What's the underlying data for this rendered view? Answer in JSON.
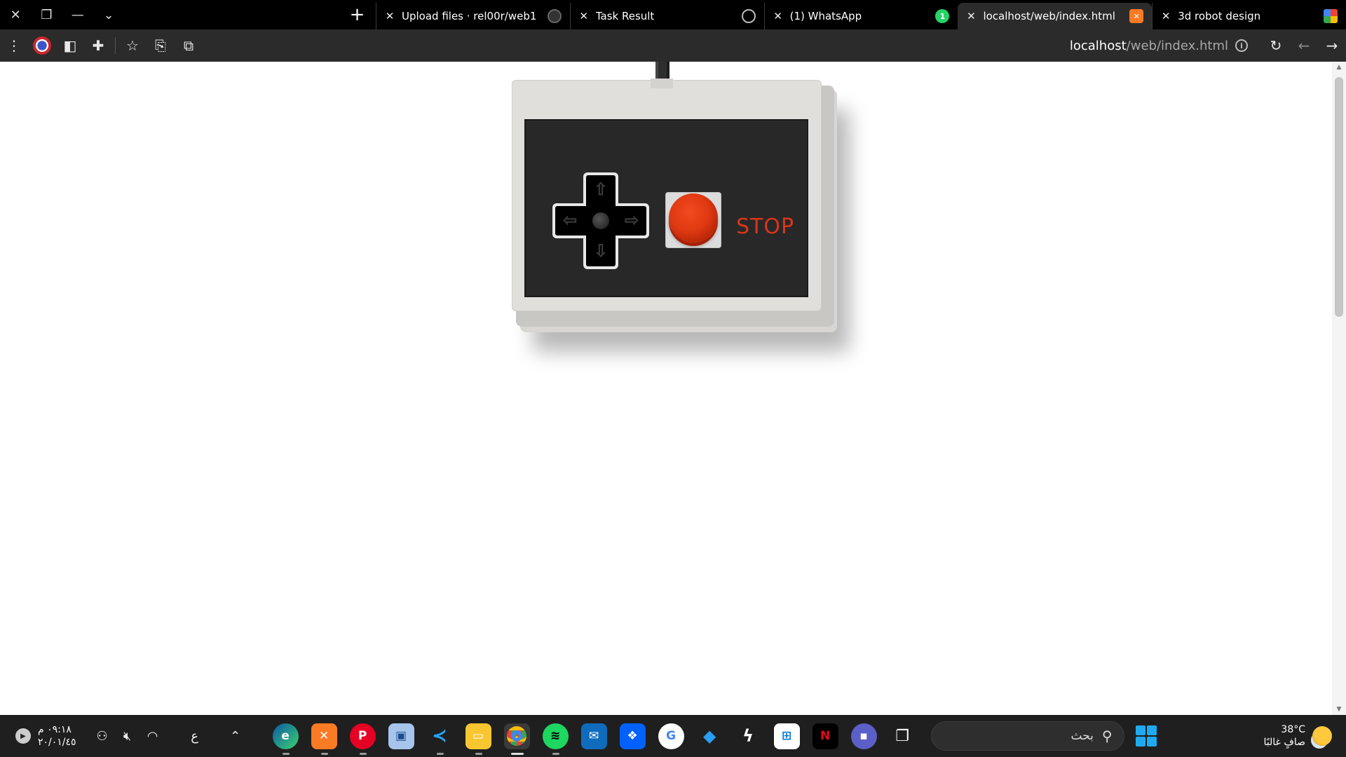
{
  "browser": {
    "window_controls": [
      "close",
      "restore",
      "minimize",
      "menu"
    ],
    "tabs": [
      {
        "title": "Upload files · rel00r/web1",
        "favicon": "github-icon"
      },
      {
        "title": "Task Result",
        "favicon": "globe-icon"
      },
      {
        "title": "(1) WhatsApp",
        "favicon": "whatsapp-icon",
        "badge": "1"
      },
      {
        "title": "localhost/web/index.html",
        "favicon": "xampp-icon",
        "active": true
      },
      {
        "title": "3d robot design",
        "favicon": "google-icon"
      }
    ],
    "address": {
      "host": "localhost",
      "path": "/web/index.html"
    }
  },
  "page": {
    "controller": {
      "stop_label": "STOP",
      "button_color": "#e03a12",
      "body_color": "#e1dfdc",
      "panel_color": "#282828"
    }
  },
  "taskbar": {
    "clock": {
      "time": "٠٩:١٨ م",
      "date": "٢٠/٠١/٤٥"
    },
    "lang": "ع",
    "search_placeholder": "بحث",
    "weather": {
      "temp": "38°C",
      "desc": "صافٍ غالبًا"
    },
    "apps": [
      "edge",
      "xampp",
      "pinterest",
      "virtualbox",
      "vscode",
      "file-explorer",
      "chrome",
      "spotify",
      "mail",
      "dropbox",
      "google",
      "roblox",
      "capcut",
      "microsoft-store",
      "netflix",
      "teams",
      "task-view"
    ]
  }
}
